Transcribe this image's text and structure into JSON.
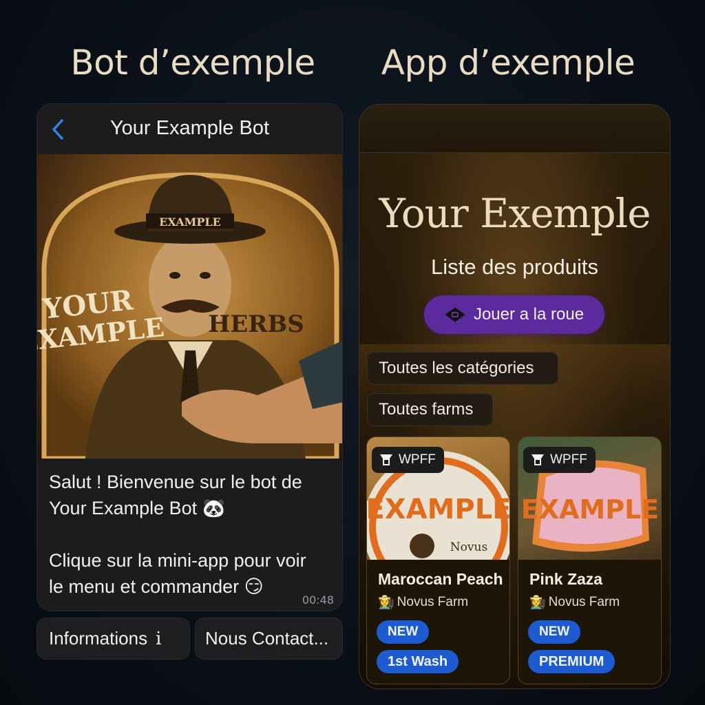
{
  "headings": {
    "bot": "Bot d’exemple",
    "app": "App d’exemple"
  },
  "bot": {
    "title": "Your Example Bot",
    "message_line1": "Salut ! Bienvenue sur le bot de\nYour Example Bot 🐼",
    "message_line2": "Clique sur la mini-app pour voir\nle menu et commander 😏",
    "time": "00:48",
    "image_text": {
      "hat": "EXAMPLE",
      "left": "YOUR\nEXAMPLE",
      "right": "HERBS"
    },
    "buttons": {
      "info": "Informations",
      "contact": "Nous Contact..."
    }
  },
  "app": {
    "title": "Your Exemple",
    "subtitle": "Liste des produits",
    "wheel_button": "Jouer a la roue",
    "filters": {
      "categories": "Toutes les catégories",
      "farms": "Toutes farms"
    },
    "products": [
      {
        "grade": "WPFF",
        "label_text": "EXAMPLE",
        "label_subtext": "Novus",
        "name": "Maroccan Peach",
        "farm": "Novus Farm",
        "tags": [
          "NEW",
          "1st Wash"
        ]
      },
      {
        "grade": "WPFF",
        "label_text": "EXAMPLE",
        "name": "Pink Zaza",
        "farm": "Novus Farm",
        "tags": [
          "NEW",
          "PREMIUM"
        ]
      }
    ]
  },
  "colors": {
    "background": "#0b1018",
    "accent_purple": "#5b2b9e",
    "tag_blue": "#1f5bd0",
    "heading": "#e8dcc4"
  }
}
